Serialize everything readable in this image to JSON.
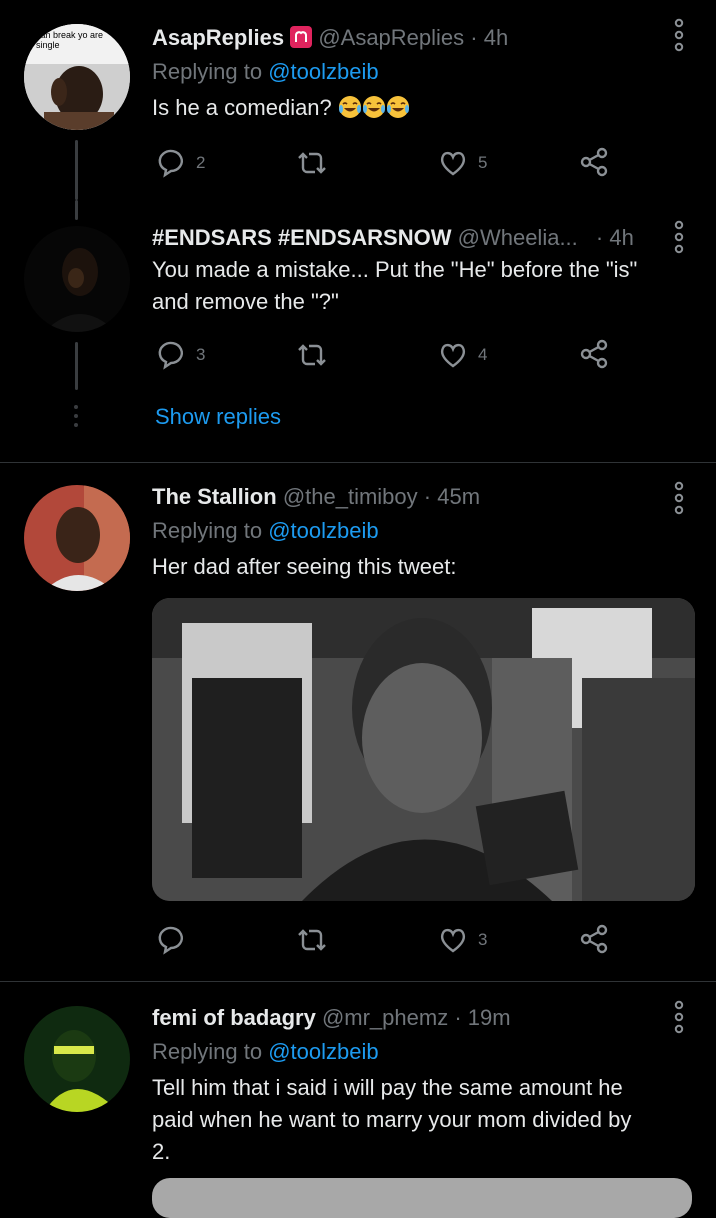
{
  "tweets": [
    {
      "name": "AsapReplies",
      "handle": "@AsapReplies",
      "separator": "·",
      "time": "4h",
      "replying_prefix": "Replying to",
      "replying_to": "@toolzbeib",
      "text": "Is he a comedian?",
      "emoji_count": 3,
      "emoji_name": "tears-of-joy",
      "avatar_caption": "can break yo are single",
      "reply_count": "2",
      "retweet_count": "",
      "like_count": "5"
    },
    {
      "name": "#ENDSARS #ENDSARSNOW",
      "handle": "@Wheelia...",
      "separator": "·",
      "time": "4h",
      "text_line1": "You made a mistake... Put the \"He\" before the \"is\"",
      "text_line2": "and remove the \"?\"",
      "reply_count": "3",
      "retweet_count": "",
      "like_count": "4",
      "show_replies": "Show replies"
    },
    {
      "name": "The Stallion",
      "handle": "@the_timiboy",
      "separator": "·",
      "time": "45m",
      "replying_prefix": "Replying to",
      "replying_to": "@toolzbeib",
      "text": "Her dad after seeing this tweet:",
      "reply_count": "",
      "retweet_count": "",
      "like_count": "3"
    },
    {
      "name": "femi of badagry",
      "handle": "@mr_phemz",
      "separator": "·",
      "time": "19m",
      "replying_prefix": "Replying to",
      "replying_to": "@toolzbeib",
      "text_line1": "Tell him that i said i will pay the same amount he",
      "text_line2": "paid when he want to marry your mom divided by",
      "text_line3": "2."
    }
  ],
  "icons": {
    "reply": "reply-icon",
    "retweet": "retweet-icon",
    "like": "heart-icon",
    "share": "share-icon",
    "more": "more-vertical-icon",
    "badge": "aries-icon"
  },
  "colors": {
    "background": "#000000",
    "link": "#1d9bf0",
    "muted": "#71767b",
    "text": "#e7e9ea",
    "aries_badge": "#e0245e"
  }
}
